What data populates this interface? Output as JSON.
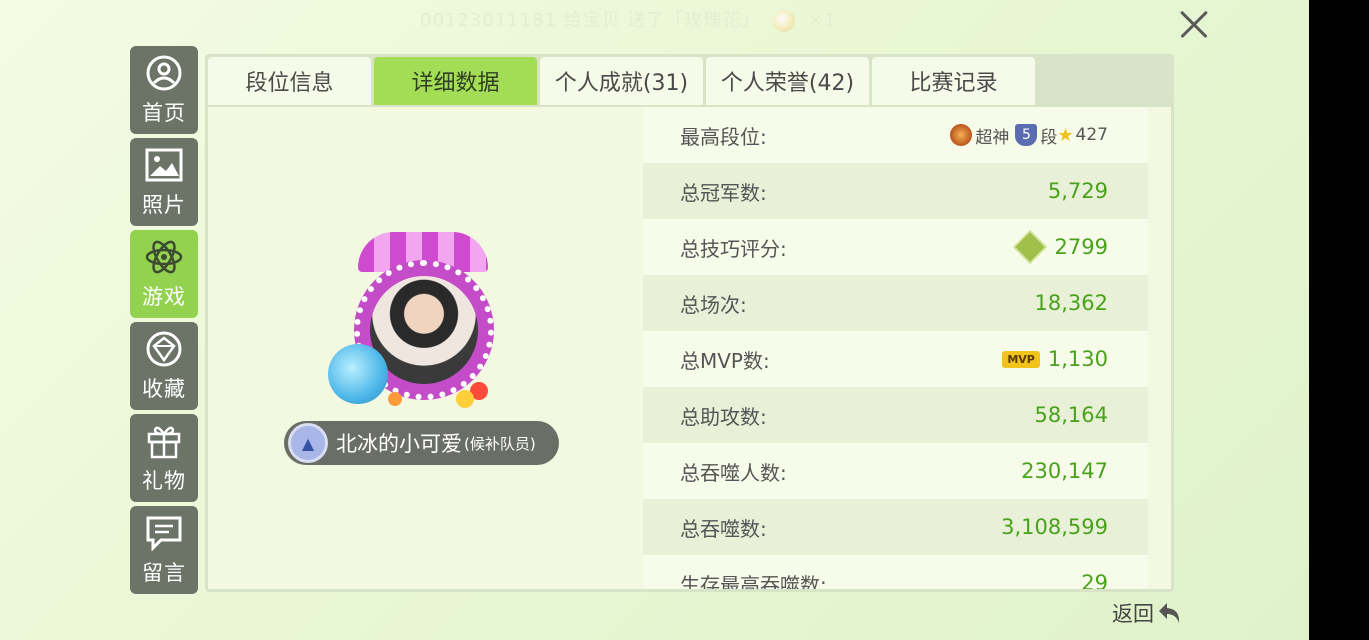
{
  "notification": {
    "text": "00123011181   给宝贝  送了「玫瑰花」",
    "count": "×1"
  },
  "sidebar": {
    "items": [
      {
        "label": "首页",
        "icon": "user-icon"
      },
      {
        "label": "照片",
        "icon": "picture-icon"
      },
      {
        "label": "游戏",
        "icon": "atom-icon",
        "active": true
      },
      {
        "label": "收藏",
        "icon": "diamond-icon"
      },
      {
        "label": "礼物",
        "icon": "gift-icon"
      },
      {
        "label": "留言",
        "icon": "message-icon"
      }
    ]
  },
  "tabs": [
    {
      "label": "段位信息"
    },
    {
      "label": "详细数据",
      "active": true
    },
    {
      "label": "个人成就(31)"
    },
    {
      "label": "个人荣誉(42)"
    },
    {
      "label": "比赛记录"
    }
  ],
  "profile": {
    "name": "北冰的小可爱",
    "role": "(候补队员)"
  },
  "stats": {
    "max_rank": {
      "label": "最高段位:",
      "tier": "超神",
      "level": "5",
      "level_suffix": "段",
      "stars": "427"
    },
    "champions": {
      "label": "总冠军数:",
      "value": "5,729"
    },
    "skill": {
      "label": "总技巧评分:",
      "value": "2799"
    },
    "games": {
      "label": "总场次:",
      "value": "18,362"
    },
    "mvp": {
      "label": "总MVP数:",
      "badge": "MVP",
      "value": "1,130"
    },
    "assists": {
      "label": "总助攻数:",
      "value": "58,164"
    },
    "devour_people": {
      "label": "总吞噬人数:",
      "value": "230,147"
    },
    "devour": {
      "label": "总吞噬数:",
      "value": "3,108,599"
    },
    "survive_max": {
      "label": "生存最高吞噬数:",
      "value": "29"
    }
  },
  "back": {
    "label": "返回"
  },
  "colors": {
    "accent_green": "#92d24f",
    "value_green": "#4aa21c",
    "sidebar_gray": "#6c7468"
  }
}
